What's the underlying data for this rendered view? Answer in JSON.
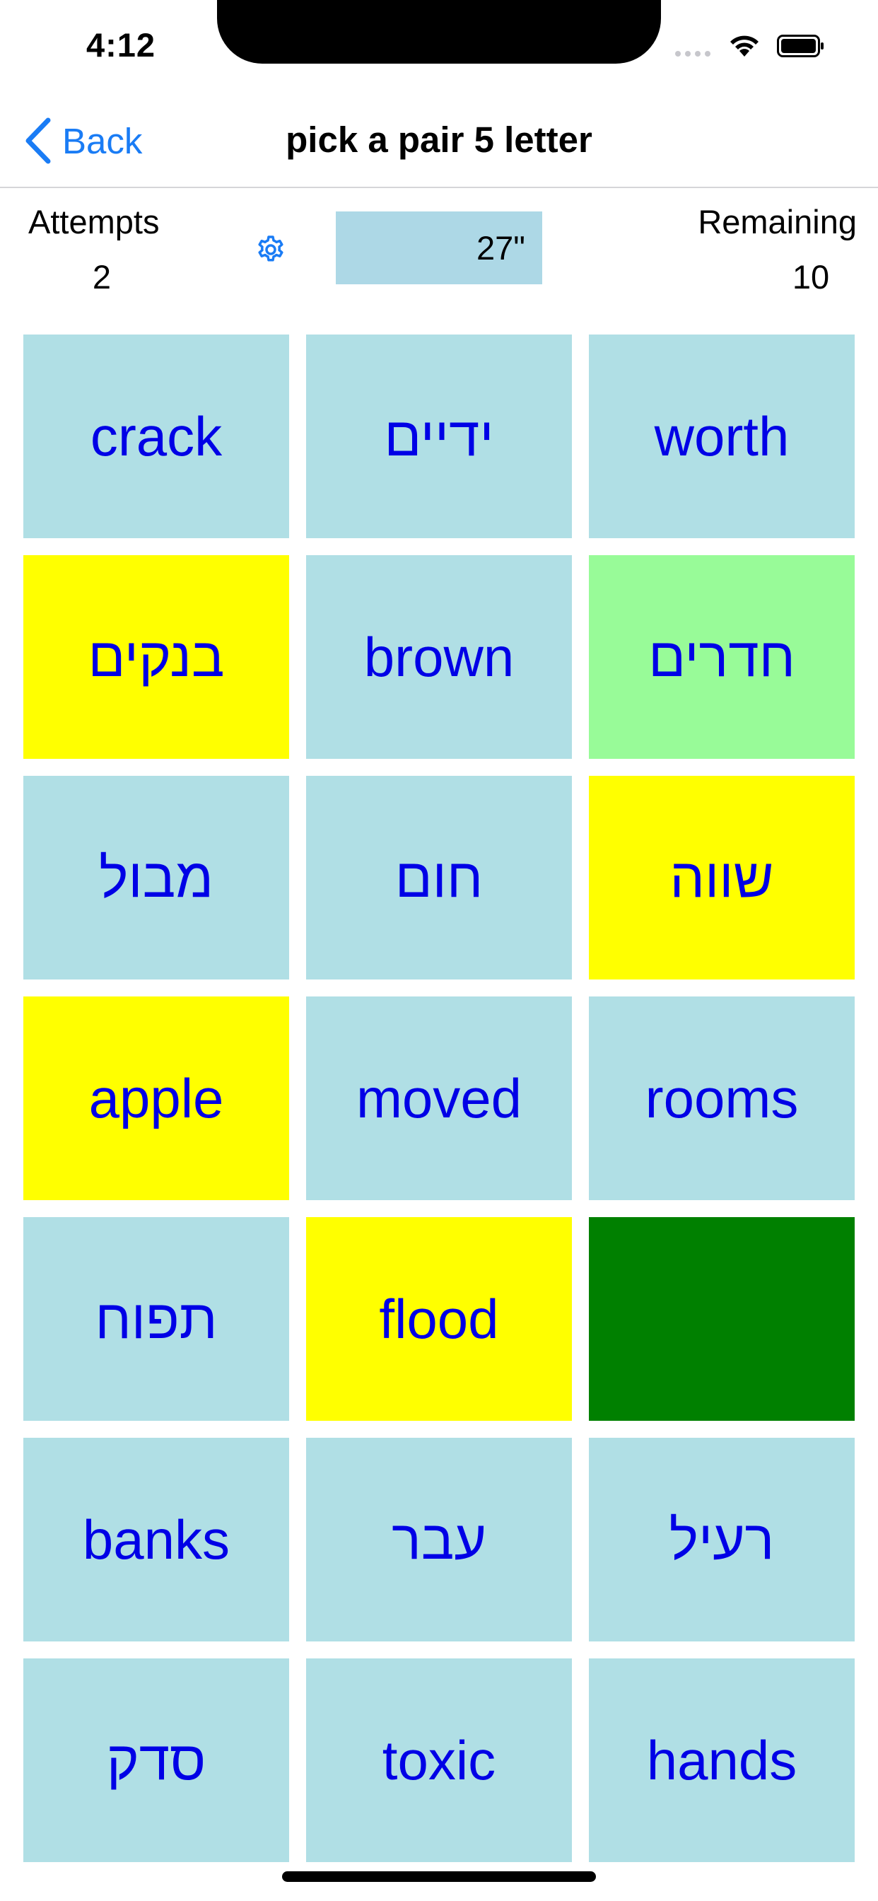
{
  "status_bar": {
    "time": "4:12",
    "signal_icon": "signal-dots-icon",
    "wifi_icon": "wifi-icon",
    "battery_icon": "battery-icon"
  },
  "nav": {
    "back_label": "Back",
    "back_icon": "chevron-left-icon",
    "title": "pick a pair 5 letter"
  },
  "stats": {
    "attempts_label": "Attempts",
    "attempts_value": "2",
    "settings_icon": "gear-icon",
    "timer": "27\"",
    "remaining_label": "Remaining",
    "remaining_value": "10"
  },
  "colors": {
    "accent": "#1a7cf5",
    "tile_default": "#b0dfe5",
    "tile_selected": "#ffff00",
    "tile_matched_light": "#98fb98",
    "tile_matched_dark": "#008000",
    "tile_text": "#0000e6",
    "timer_bg": "#add8e6"
  },
  "tiles": [
    {
      "label": "crack",
      "state": "default"
    },
    {
      "label": "ידיים",
      "state": "default"
    },
    {
      "label": "worth",
      "state": "default"
    },
    {
      "label": "בנקים",
      "state": "selected"
    },
    {
      "label": "brown",
      "state": "default"
    },
    {
      "label": "חדרים",
      "state": "matched_light"
    },
    {
      "label": "מבול",
      "state": "default"
    },
    {
      "label": "חום",
      "state": "default"
    },
    {
      "label": "שווה",
      "state": "selected"
    },
    {
      "label": "apple",
      "state": "selected"
    },
    {
      "label": "moved",
      "state": "default"
    },
    {
      "label": "rooms",
      "state": "default"
    },
    {
      "label": "תפוח",
      "state": "default"
    },
    {
      "label": "flood",
      "state": "selected"
    },
    {
      "label": "",
      "state": "matched_dark"
    },
    {
      "label": "banks",
      "state": "default"
    },
    {
      "label": "עבר",
      "state": "default"
    },
    {
      "label": "רעיל",
      "state": "default"
    },
    {
      "label": "סדק",
      "state": "default"
    },
    {
      "label": "toxic",
      "state": "default"
    },
    {
      "label": "hands",
      "state": "default"
    }
  ]
}
